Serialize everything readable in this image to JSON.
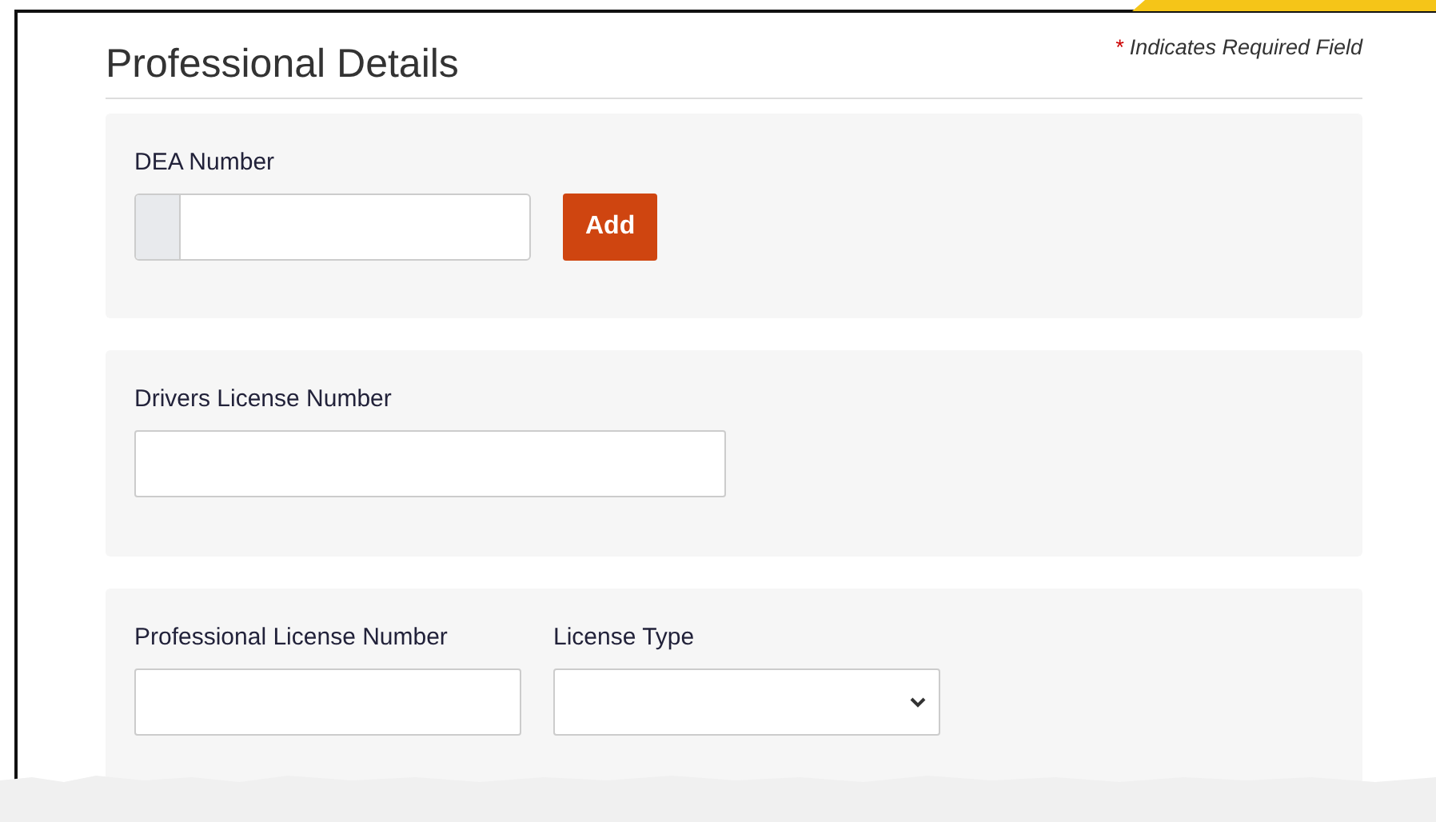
{
  "section": {
    "title": "Professional Details",
    "required_note": {
      "mark": "*",
      "text": "Indicates Required Field"
    }
  },
  "cards": [
    {
      "kind": "dea",
      "fields": [
        {
          "label": "DEA Number",
          "kind": "prefixed"
        }
      ],
      "button": "Add"
    },
    {
      "kind": "plain",
      "fields": [
        {
          "label": "Drivers License Number",
          "kind": "text"
        }
      ]
    },
    {
      "kind": "plain",
      "fields": [
        {
          "label": "Professional License Number",
          "kind": "text"
        },
        {
          "label": "License Type",
          "kind": "select"
        }
      ]
    }
  ]
}
